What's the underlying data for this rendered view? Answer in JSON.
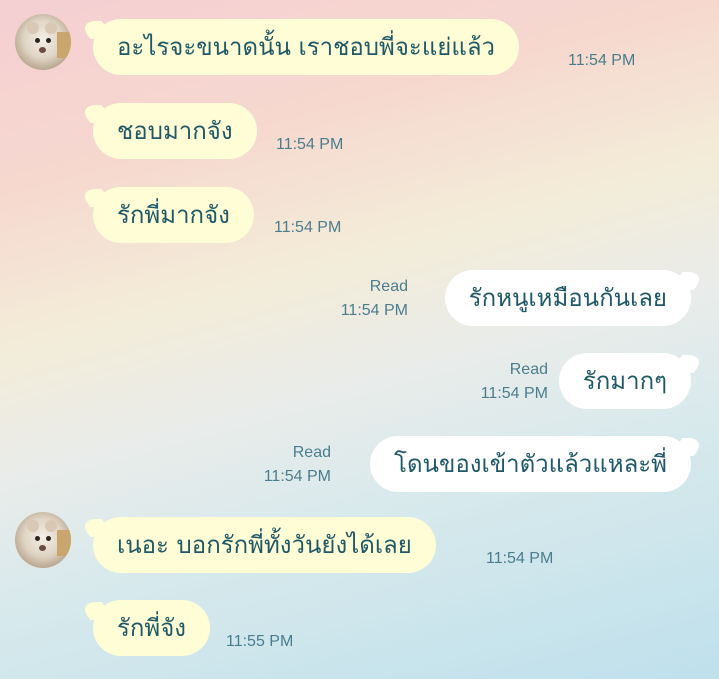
{
  "messages": [
    {
      "side": "in",
      "text": "อะไรจะขนาดนั้น เราชอบพี่จะแย่แล้ว",
      "time": "11:54 PM",
      "avatar": true
    },
    {
      "side": "in",
      "text": "ชอบมากจัง",
      "time": "11:54 PM"
    },
    {
      "side": "in",
      "text": "รักพี่มากจัง",
      "time": "11:54 PM"
    },
    {
      "side": "out",
      "text": "รักหนูเหมือนกันเลย",
      "status": "Read",
      "time": "11:54 PM"
    },
    {
      "side": "out",
      "text": "รักมากๆ",
      "status": "Read",
      "time": "11:54 PM"
    },
    {
      "side": "out",
      "text": "โดนของเข้าตัวแล้วแหละพี่",
      "status": "Read",
      "time": "11:54 PM"
    },
    {
      "side": "in",
      "text": "เนอะ บอกรักพี่ทั้งวันยังได้เลย",
      "time": "11:54 PM",
      "avatar": true
    },
    {
      "side": "in",
      "text": "รักพี่จัง",
      "time": "11:55 PM"
    }
  ]
}
